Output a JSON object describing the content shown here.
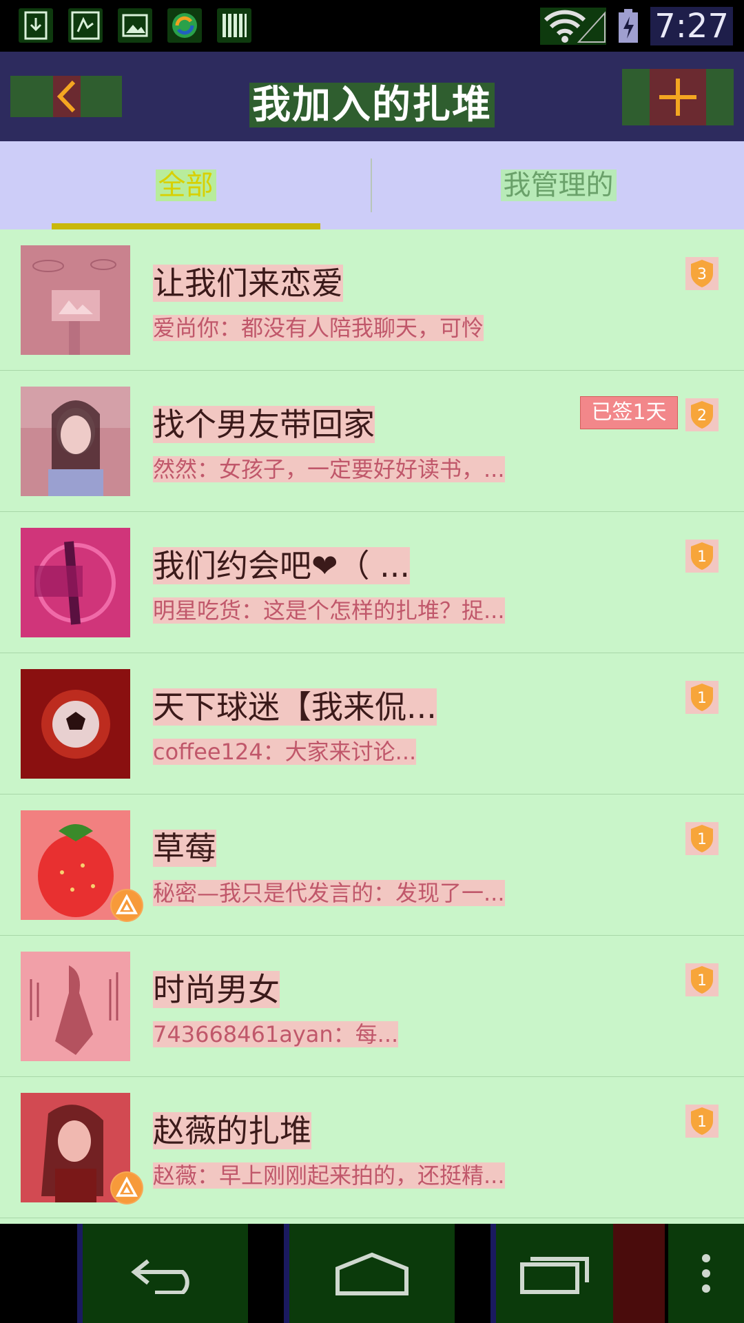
{
  "status_bar": {
    "time": "7:27",
    "left_icons": [
      "download-icon",
      "app-icon",
      "gallery-icon",
      "sync-icon",
      "barcode-icon"
    ],
    "right_icons": [
      "wifi-icon",
      "signal-icon",
      "battery-icon"
    ]
  },
  "title_bar": {
    "title": "我加入的扎堆",
    "back_icon": "chevron-left-icon",
    "add_icon": "plus-icon"
  },
  "tabs": [
    {
      "label": "全部",
      "active": true
    },
    {
      "label": "我管理的",
      "active": false
    }
  ],
  "colors": {
    "title_bar_bg": "#2d2b5e",
    "tab_bar_bg": "#cdcdf8",
    "list_bg": "#c9f5c9",
    "active_tab": "#c9b80a",
    "badge_orange": "#f79a3a"
  },
  "groups": [
    {
      "title": "让我们来恋爱",
      "last_message": "爱尚你：都没有人陪我聊天，可怜",
      "level": "3",
      "signed": "",
      "vip": false
    },
    {
      "title": "找个男友带回家",
      "last_message": "然然：女孩子，一定要好好读书，...",
      "level": "2",
      "signed": "已签1天",
      "vip": false
    },
    {
      "title": "我们约会吧❤（ ...",
      "last_message": "明星吃货：这是个怎样的扎堆？捉...",
      "level": "1",
      "signed": "",
      "vip": false
    },
    {
      "title": "天下球迷【我来侃...",
      "last_message": "coffee124：大家来讨论...",
      "level": "1",
      "signed": "",
      "vip": false
    },
    {
      "title": "草莓",
      "last_message": "秘密—我只是代发言的：发现了一...",
      "level": "1",
      "signed": "",
      "vip": true
    },
    {
      "title": "时尚男女",
      "last_message": "743668461ayan：每...",
      "level": "1",
      "signed": "",
      "vip": false
    },
    {
      "title": "赵薇的扎堆",
      "last_message": "赵薇：早上刚刚起来拍的，还挺精...",
      "level": "1",
      "signed": "",
      "vip": true
    }
  ],
  "nav_bar": {
    "icons": [
      "back-icon",
      "home-icon",
      "recent-apps-icon",
      "overflow-menu-icon"
    ]
  }
}
